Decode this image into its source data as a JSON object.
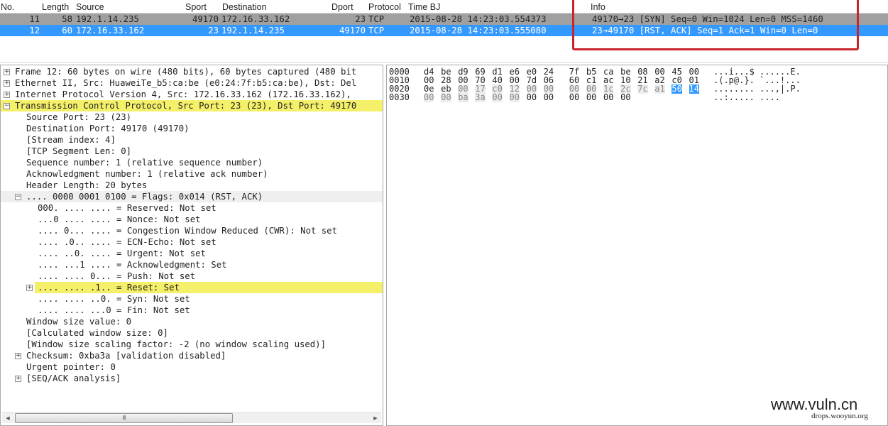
{
  "packet_list": {
    "columns": [
      "No.",
      "Length",
      "Source",
      "Sport",
      "Destination",
      "Dport",
      "Protocol",
      "Time BJ",
      "Info"
    ],
    "rows": [
      {
        "no": "11",
        "length": "58",
        "source": "192.1.14.235",
        "sport": "49170",
        "destination": "172.16.33.162",
        "dport": "23",
        "protocol": "TCP",
        "time": "2015-08-28 14:23:03.554373",
        "info": "49170→23 [SYN] Seq=0 Win=1024 Len=0 MSS=1460",
        "state": "marked"
      },
      {
        "no": "12",
        "length": "60",
        "source": "172.16.33.162",
        "sport": "23",
        "destination": "192.1.14.235",
        "dport": "49170",
        "protocol": "TCP",
        "time": "2015-08-28 14:23:03.555080",
        "info": "23→49170 [RST, ACK] Seq=1 Ack=1 Win=0 Len=0",
        "state": "selected"
      }
    ],
    "annotation_color": "#c8242b",
    "selected_color": "#3399ff",
    "marked_color": "#a0a0a0"
  },
  "detail_tree": [
    {
      "text": "Frame 12: 60 bytes on wire (480 bits), 60 bytes captured (480 bit",
      "level": 0,
      "toggle": "+"
    },
    {
      "text": "Ethernet II, Src: HuaweiTe_b5:ca:be (e0:24:7f:b5:ca:be), Dst: Del",
      "level": 0,
      "toggle": "+"
    },
    {
      "text": "Internet Protocol Version 4, Src: 172.16.33.162 (172.16.33.162), ",
      "level": 0,
      "toggle": "+"
    },
    {
      "text": "Transmission Control Protocol, Src Port: 23 (23), Dst Port: 49170",
      "level": 0,
      "toggle": "-",
      "highlight": "yellow"
    },
    {
      "text": "Source Port: 23 (23)",
      "level": 1
    },
    {
      "text": "Destination Port: 49170 (49170)",
      "level": 1
    },
    {
      "text": "[Stream index: 4]",
      "level": 1
    },
    {
      "text": "[TCP Segment Len: 0]",
      "level": 1
    },
    {
      "text": "Sequence number: 1    (relative sequence number)",
      "level": 1
    },
    {
      "text": "Acknowledgment number: 1    (relative ack number)",
      "level": 1
    },
    {
      "text": "Header Length: 20 bytes",
      "level": 1
    },
    {
      "text": ".... 0000 0001 0100 = Flags: 0x014 (RST, ACK)",
      "level": 1,
      "toggle": "-",
      "highlight": "gray"
    },
    {
      "text": "000. .... .... = Reserved: Not set",
      "level": 2
    },
    {
      "text": "...0 .... .... = Nonce: Not set",
      "level": 2
    },
    {
      "text": ".... 0... .... = Congestion Window Reduced (CWR): Not set",
      "level": 2
    },
    {
      "text": ".... .0.. .... = ECN-Echo: Not set",
      "level": 2
    },
    {
      "text": ".... ..0. .... = Urgent: Not set",
      "level": 2
    },
    {
      "text": ".... ...1 .... = Acknowledgment: Set",
      "level": 2
    },
    {
      "text": ".... .... 0... = Push: Not set",
      "level": 2
    },
    {
      "text": ".... .... .1.. = Reset: Set",
      "level": 2,
      "toggle": "+",
      "highlight": "reset"
    },
    {
      "text": ".... .... ..0. = Syn: Not set",
      "level": 2
    },
    {
      "text": ".... .... ...0 = Fin: Not set",
      "level": 2
    },
    {
      "text": "Window size value: 0",
      "level": 1
    },
    {
      "text": "[Calculated window size: 0]",
      "level": 1
    },
    {
      "text": "[Window size scaling factor: -2 (no window scaling used)]",
      "level": 1
    },
    {
      "text": "Checksum: 0xba3a [validation disabled]",
      "level": 1,
      "toggle": "+"
    },
    {
      "text": "Urgent pointer: 0",
      "level": 1
    },
    {
      "text": "[SEQ/ACK analysis]",
      "level": 1,
      "toggle": "+"
    }
  ],
  "detail_scrollbar": {
    "thumb_glyph": "III",
    "left_arrow": "◀",
    "right_arrow": "▶"
  },
  "hex_dump": [
    {
      "offset": "0000",
      "bytes": [
        "d4",
        "be",
        "d9",
        "69",
        "d1",
        "e6",
        "e0",
        "24",
        "7f",
        "b5",
        "ca",
        "be",
        "08",
        "00",
        "45",
        "00"
      ],
      "ascii": "...i...$ ......E."
    },
    {
      "offset": "0010",
      "bytes": [
        "00",
        "28",
        "00",
        "70",
        "40",
        "00",
        "7d",
        "06",
        "60",
        "c1",
        "ac",
        "10",
        "21",
        "a2",
        "c0",
        "01"
      ],
      "ascii": ".(.p@.}. `...!..."
    },
    {
      "offset": "0020",
      "bytes": [
        "0e",
        "eb",
        "00",
        "17",
        "c0",
        "12",
        "00",
        "00",
        "00",
        "00",
        "1c",
        "2c",
        "7c",
        "a1",
        "50",
        "14"
      ],
      "ascii": "........ ...,|.P."
    },
    {
      "offset": "0030",
      "bytes": [
        "00",
        "00",
        "ba",
        "3a",
        "00",
        "00",
        "00",
        "00",
        "00",
        "00",
        "00",
        "00"
      ],
      "ascii": "..:..... ...."
    }
  ],
  "watermark": {
    "main": "www.vuln.cn",
    "sub": "drops.wooyun.org"
  }
}
